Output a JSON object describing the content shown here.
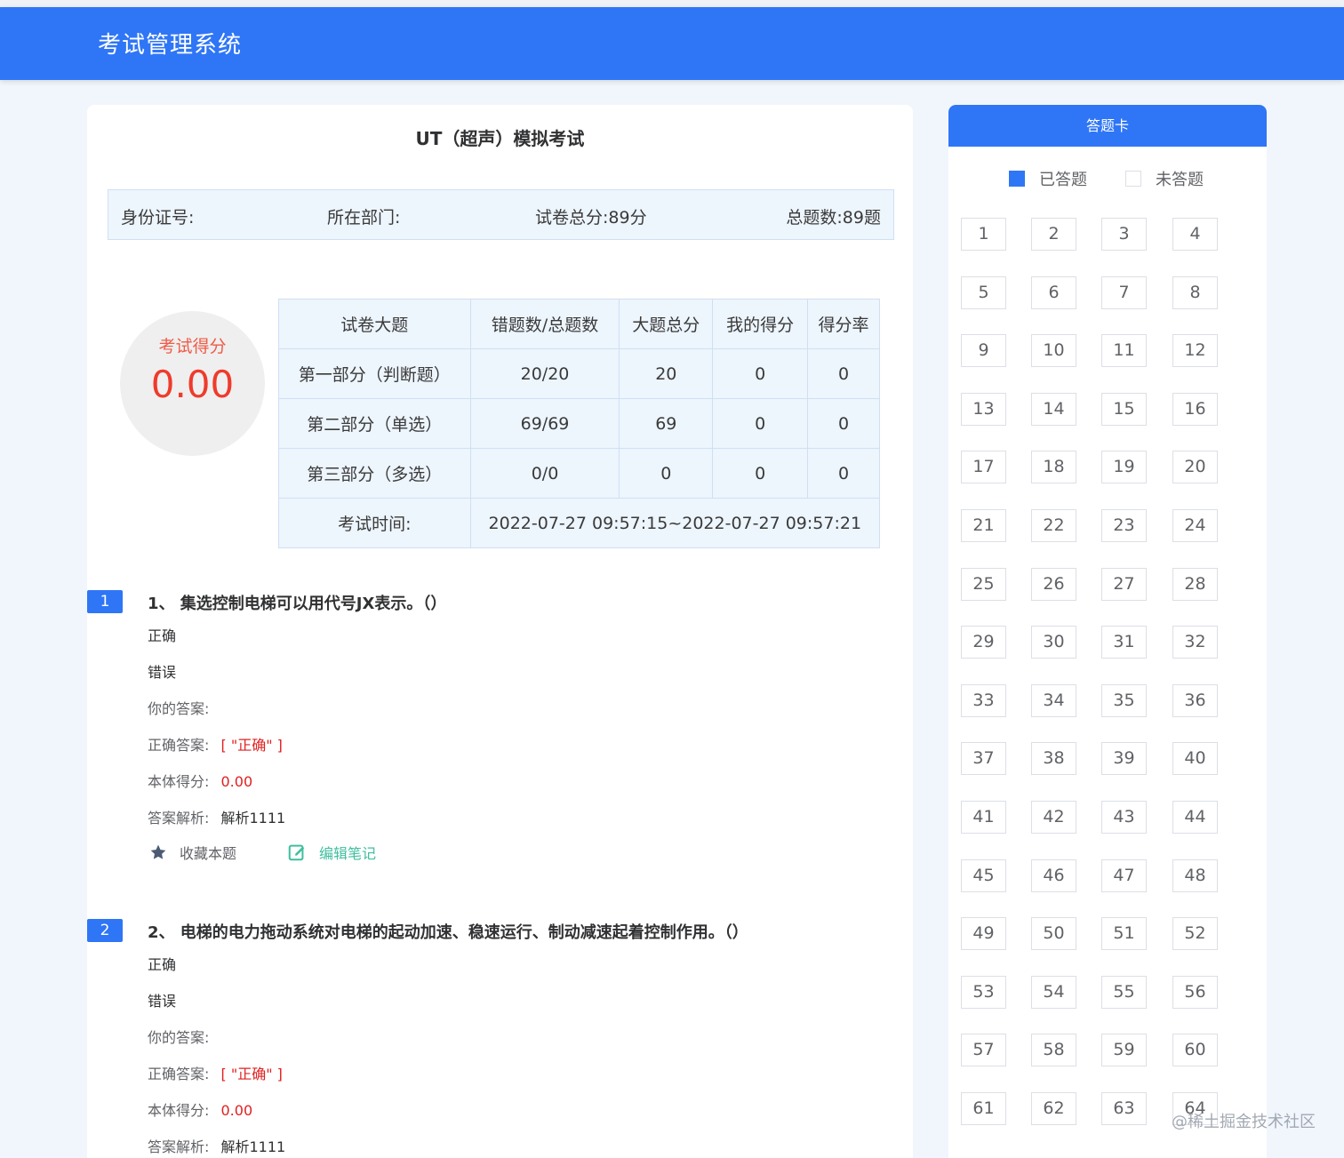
{
  "header": {
    "title": "考试管理系统"
  },
  "exam": {
    "title": "UT（超声）模拟考试",
    "info": {
      "id_label": "身份证号:",
      "dept_label": "所在部门:",
      "total_score": "试卷总分:89分",
      "total_questions": "总题数:89题"
    },
    "score_label": "考试得分",
    "score_value": "0.00",
    "summary_headers": [
      "试卷大题",
      "错题数/总题数",
      "大题总分",
      "我的得分",
      "得分率"
    ],
    "summary_rows": [
      [
        "第一部分（判断题）",
        "20/20",
        "20",
        "0",
        "0"
      ],
      [
        "第二部分（单选）",
        "69/69",
        "69",
        "0",
        "0"
      ],
      [
        "第三部分（多选）",
        "0/0",
        "0",
        "0",
        "0"
      ]
    ],
    "time_label": "考试时间:",
    "time_value": "2022-07-27 09:57:15~2022-07-27 09:57:21"
  },
  "questions": [
    {
      "badge": "1",
      "text": "1、 集选控制电梯可以用代号JX表示。（）",
      "options": [
        "正确",
        "错误"
      ],
      "your_answer_label": "你的答案:",
      "correct_label": "正确答案:",
      "correct_value": "[ \"正确\" ]",
      "score_label": "本体得分:",
      "score_value": "0.00",
      "analysis_label": "答案解析:",
      "analysis_value": "解析1111",
      "favorite_label": "收藏本题",
      "note_label": "编辑笔记"
    },
    {
      "badge": "2",
      "text": "2、 电梯的电力拖动系统对电梯的起动加速、稳速运行、制动减速起着控制作用。（）",
      "options": [
        "正确",
        "错误"
      ],
      "your_answer_label": "你的答案:",
      "correct_label": "正确答案:",
      "correct_value": "[ \"正确\" ]",
      "score_label": "本体得分:",
      "score_value": "0.00",
      "analysis_label": "答案解析:",
      "analysis_value": "解析1111"
    }
  ],
  "answer_card": {
    "title": "答题卡",
    "legend_answered": "已答题",
    "legend_unanswered": "未答题",
    "numbers": [
      "1",
      "2",
      "3",
      "4",
      "5",
      "6",
      "7",
      "8",
      "9",
      "10",
      "11",
      "12",
      "13",
      "14",
      "15",
      "16",
      "17",
      "18",
      "19",
      "20",
      "21",
      "22",
      "23",
      "24",
      "25",
      "26",
      "27",
      "28",
      "29",
      "30",
      "31",
      "32",
      "33",
      "34",
      "35",
      "36",
      "37",
      "38",
      "39",
      "40",
      "41",
      "42",
      "43",
      "44",
      "45",
      "46",
      "47",
      "48",
      "49",
      "50",
      "51",
      "52",
      "53",
      "54",
      "55",
      "56",
      "57",
      "58",
      "59",
      "60",
      "61",
      "62",
      "63",
      "64"
    ]
  },
  "watermark": "@稀土掘金技术社区",
  "colors": {
    "primary": "#2f76f6",
    "danger": "#e02020",
    "note": "#3fbf9f"
  }
}
